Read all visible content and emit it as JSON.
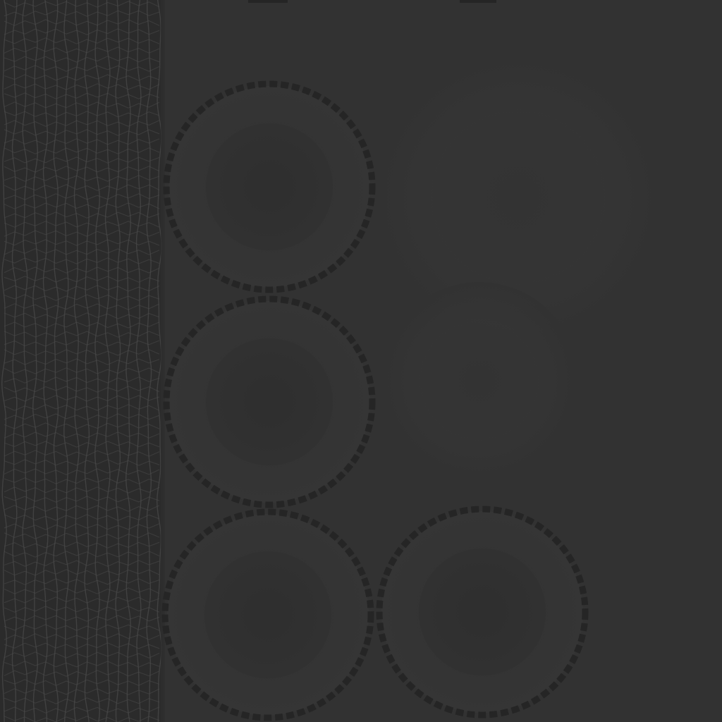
{
  "colors": {
    "background": "#323232",
    "strip_background": "#2b2b2b",
    "strip_weave": "#4a4a4a",
    "ring_outer_dash": "#252525",
    "ring_face": "#353535",
    "ring_inner_shadow": "#2f2f2f",
    "ghost_face": "#363636"
  },
  "decor": {
    "left_strip": "woven-texture",
    "rings": [
      {
        "id": "ring-top-left",
        "style": "dashed-border"
      },
      {
        "id": "ring-middle-left",
        "style": "dashed-border"
      },
      {
        "id": "ring-bottom-left",
        "style": "dashed-border"
      },
      {
        "id": "ring-bottom-right",
        "style": "dashed-border"
      }
    ],
    "ghost_discs": [
      {
        "id": "ghost-top-right"
      },
      {
        "id": "ghost-middle-right"
      }
    ],
    "top_ticks": [
      {
        "id": "top-tick-left"
      },
      {
        "id": "top-tick-right"
      }
    ]
  }
}
